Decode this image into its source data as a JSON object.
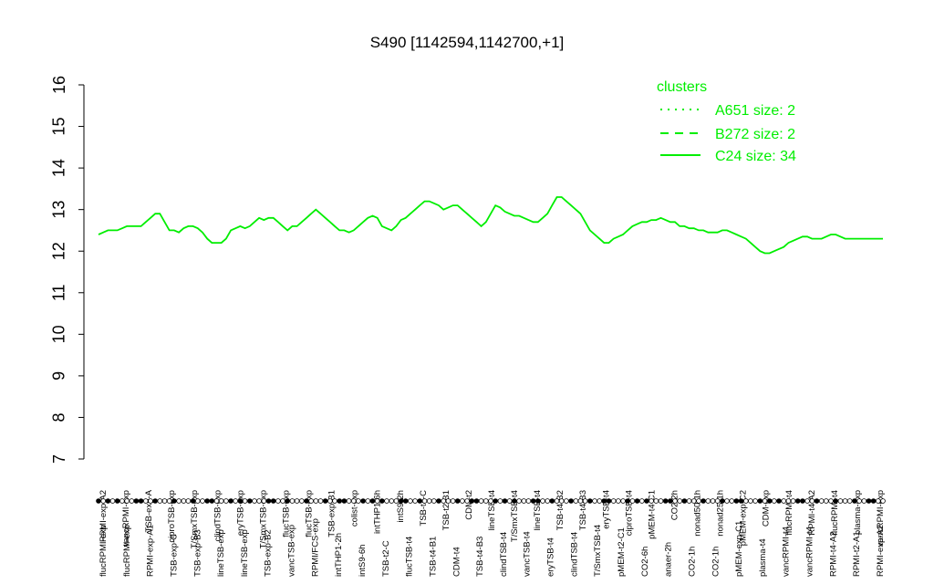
{
  "chart_data": {
    "type": "line",
    "title": "S490 [1142594,1142700,+1]",
    "xlabel": "",
    "ylabel": "",
    "ylim": [
      7,
      16
    ],
    "yticks": [
      7,
      8,
      9,
      10,
      11,
      12,
      13,
      14,
      15,
      16
    ],
    "grid": false,
    "legend": {
      "title": "clusters",
      "placement": "top-right",
      "color": "#00ee00",
      "entries": [
        {
          "label": "A651 size: 2",
          "style": "dotted"
        },
        {
          "label": "B272 size: 2",
          "style": "dashed"
        },
        {
          "label": "C24 size: 34",
          "style": "solid"
        }
      ]
    },
    "top_labels": [
      "RPMI-exp-A2",
      "vancRPMI-exp",
      "TSB-exp-A",
      "ciproTSB-exp",
      "T/SmxTSB-exp",
      "clindTSB-exp",
      "eryTSB-exp",
      "T/SmxTSB-exp",
      "flucTSB-exp",
      "flucTSB-exp",
      "TSB-exp-B1",
      "colist-exp",
      "intTHP1-6h",
      "intS9-2h",
      "TSB-t4-C",
      "TSB-t2-B1",
      "CDM-t2",
      "lineTSB-t4",
      "T/SmxTSB-t4",
      "lineTSB-t4",
      "TSB-t4-B2",
      "TSB-t4-B3",
      "eryTSB-t4",
      "ciproTSB-t4",
      "pMEM-t4-C1",
      "CO2-2h",
      "nonad50-1h",
      "nonad25-1h",
      "pMEM-exp-C2",
      "CDM-exp",
      "flucRPMI-t4",
      "RPMI-t4-A2",
      "flucRPMI-t4",
      "plasma-exp",
      "vancRPMI-exp"
    ],
    "bottom_labels": [
      "flucRPMI-exp",
      "flucRPMI-exp",
      "RPMI-exp-A1",
      "TSB-exp-C",
      "TSB-exp-B3",
      "lineTSB-exp",
      "lineTSB-exp",
      "TSB-exp-B2",
      "vancTSB-exp",
      "RPMI/FCS-exp",
      "intTHP1-2h",
      "intS9-6h",
      "TSB-t2-C",
      "flucTSB-t4",
      "TSB-t4-B1",
      "CDM-t4",
      "TSB-t4-B3",
      "clindTSB-t4",
      "vancTSB-t4",
      "eryTSB-t4",
      "clindTSB-t4",
      "T/SmxTSB-t4",
      "pMEM-t2-C1",
      "CO2-6h",
      "anaer-2h",
      "CO2-1h",
      "CO2-1h",
      "pMEM-exp-C1",
      "plasma-t4",
      "vancRPMI-t4",
      "vancRPMI-t4",
      "RPMI-t4-A2",
      "RPMI-t2-A1",
      "RPMI-exp-A2"
    ],
    "x": [
      1,
      2,
      3,
      4,
      5,
      6,
      7,
      8,
      9,
      10,
      11,
      12,
      13,
      14,
      15,
      16,
      17,
      18,
      19,
      20,
      21,
      22,
      23,
      24,
      25,
      26,
      27,
      28,
      29,
      30,
      31,
      32,
      33,
      34,
      35,
      36,
      37,
      38,
      39,
      40,
      41,
      42,
      43,
      44,
      45,
      46,
      47,
      48,
      49,
      50,
      51,
      52,
      53,
      54,
      55,
      56,
      57,
      58,
      59,
      60,
      61,
      62,
      63,
      64,
      65,
      66,
      67,
      68,
      69,
      70,
      71,
      72,
      73,
      74,
      75,
      76,
      77,
      78,
      79,
      80,
      81,
      82,
      83,
      84,
      85,
      86,
      87,
      88,
      89,
      90,
      91,
      92,
      93,
      94,
      95,
      96,
      97,
      98,
      99,
      100,
      101,
      102,
      103,
      104,
      105,
      106,
      107,
      108,
      109,
      110,
      111,
      112,
      113,
      114,
      115,
      116,
      117,
      118,
      119,
      120,
      121,
      122,
      123,
      124,
      125,
      126,
      127,
      128,
      129,
      130,
      131,
      132,
      133,
      134,
      135,
      136,
      137,
      138,
      139,
      140,
      141,
      142,
      143,
      144,
      145,
      146,
      147,
      148,
      149,
      150,
      151,
      152,
      153,
      154,
      155,
      156,
      157,
      158,
      159,
      160,
      161,
      162,
      163,
      164,
      165,
      166,
      167
    ],
    "series": [
      {
        "line": "solid",
        "color": "#00ee00",
        "values": [
          12.4,
          12.45,
          12.5,
          12.5,
          12.5,
          12.55,
          12.6,
          12.6,
          12.6,
          12.6,
          12.7,
          12.8,
          12.9,
          12.9,
          12.7,
          12.5,
          12.5,
          12.45,
          12.55,
          12.6,
          12.6,
          12.55,
          12.45,
          12.3,
          12.2,
          12.2,
          12.2,
          12.3,
          12.5,
          12.55,
          12.6,
          12.55,
          12.6,
          12.7,
          12.8,
          12.75,
          12.8,
          12.8,
          12.7,
          12.6,
          12.5,
          12.6,
          12.6,
          12.7,
          12.8,
          12.9,
          13.0,
          12.9,
          12.8,
          12.7,
          12.6,
          12.5,
          12.5,
          12.45,
          12.5,
          12.6,
          12.7,
          12.8,
          12.85,
          12.8,
          12.6,
          12.55,
          12.5,
          12.6,
          12.75,
          12.8,
          12.9,
          13.0,
          13.1,
          13.2,
          13.2,
          13.15,
          13.1,
          13.0,
          13.05,
          13.1,
          13.1,
          13.0,
          12.9,
          12.8,
          12.7,
          12.6,
          12.7,
          12.9,
          13.1,
          13.05,
          12.95,
          12.9,
          12.85,
          12.85,
          12.8,
          12.75,
          12.7,
          12.7,
          12.8,
          12.9,
          13.1,
          13.3,
          13.3,
          13.2,
          13.1,
          13.0,
          12.9,
          12.7,
          12.5,
          12.4,
          12.3,
          12.2,
          12.2,
          12.3,
          12.35,
          12.4,
          12.5,
          12.6,
          12.65,
          12.7,
          12.7,
          12.75,
          12.75,
          12.8,
          12.75,
          12.7,
          12.7,
          12.6,
          12.6,
          12.55,
          12.55,
          12.5,
          12.5,
          12.45,
          12.45,
          12.45,
          12.5,
          12.5,
          12.45,
          12.4,
          12.35,
          12.3,
          12.2,
          12.1,
          12.0,
          11.95,
          11.95,
          12.0,
          12.05,
          12.1,
          12.2,
          12.25,
          12.3,
          12.35,
          12.35,
          12.3,
          12.3,
          12.3,
          12.35,
          12.4,
          12.4,
          12.35,
          12.3,
          12.3,
          12.3,
          12.3,
          12.3,
          12.3,
          12.3,
          12.3,
          12.3,
          12.3,
          12.3
        ]
      }
    ]
  }
}
